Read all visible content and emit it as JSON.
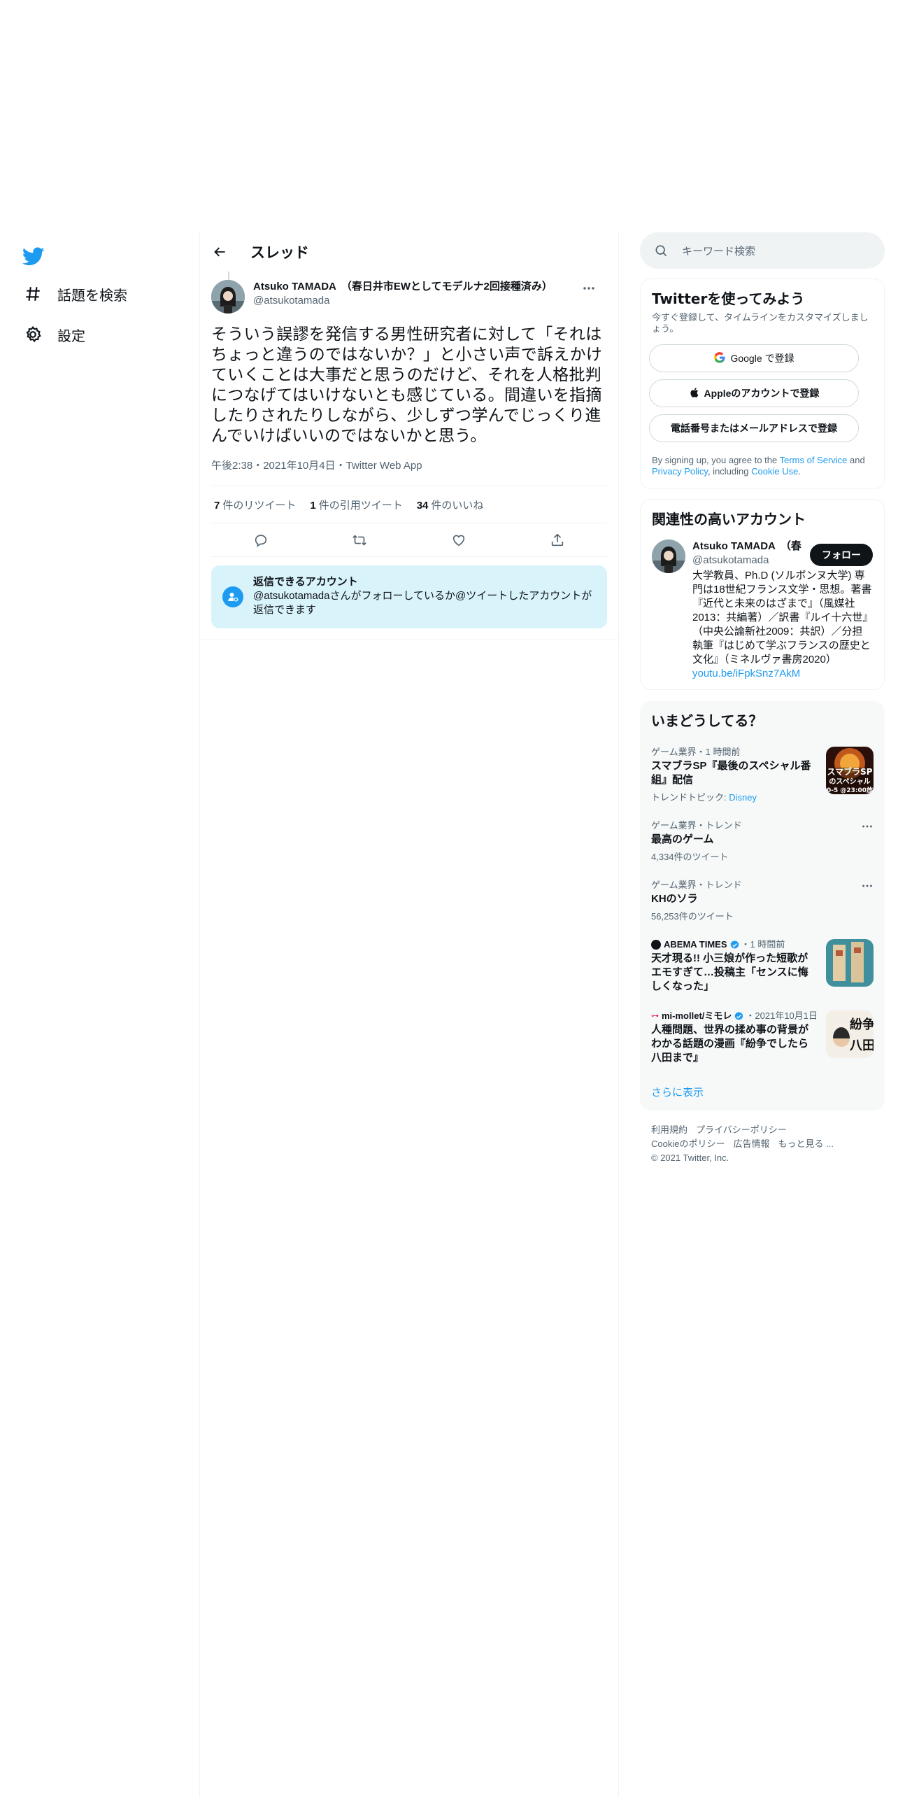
{
  "nav": {
    "items": [
      {
        "label": "話題を検索",
        "icon": "hashtag-icon"
      },
      {
        "label": "設定",
        "icon": "gear-icon"
      }
    ]
  },
  "header": {
    "title": "スレッド"
  },
  "tweet": {
    "display_name": "Atsuko TAMADA　（春日井市EWとしてモデルナ2回接種済み）",
    "handle": "@atsukotamada",
    "text": "そういう誤謬を発信する男性研究者に対して「それはちょっと違うのではないか？」と小さい声で訴えかけていくことは大事だと思うのだけど、それを人格批判につなげてはいけないとも感じている。間違いを指摘したりされたりしながら、少しずつ学んでじっくり進んでいけばいいのではないかと思う。",
    "meta": "午後2:38・2021年10月4日・Twitter Web App",
    "stats": [
      {
        "count": "7",
        "label": "件のリツイート"
      },
      {
        "count": "1",
        "label": "件の引用ツイート"
      },
      {
        "count": "34",
        "label": "件のいいね"
      }
    ],
    "reply_box": {
      "title": "返信できるアカウント",
      "text": "@atsukotamadaさんがフォローしているか@ツイートしたアカウントが返信できます"
    }
  },
  "search": {
    "placeholder": "キーワード検索"
  },
  "signup": {
    "title": "Twitterを使ってみよう",
    "subtitle": "今すぐ登録して、タイムラインをカスタマイズしましょう。",
    "google_label": "Google で登録",
    "apple_label": "Appleのアカウントで登録",
    "phone_label": "電話番号またはメールアドレスで登録",
    "terms_prefix": "By signing up, you agree to the ",
    "terms_link": "Terms of Service",
    "terms_and": " and ",
    "privacy_link": "Privacy Policy",
    "terms_including": ", including ",
    "cookie_link": "Cookie Use",
    "terms_end": "."
  },
  "relevant": {
    "title": "関連性の高いアカウント",
    "name": "Atsuko TAMADA　（春",
    "handle": "@atsukotamada",
    "follow_label": "フォロー",
    "bio": "大学教員、Ph.D (ソルボンヌ大学) 専門は18世紀フランス文学・思想。著書『近代と未来のはざまで』（風媒社2013：共編著）／訳書『ルイ十六世』（中央公論新社2009：共訳）／分担執筆『はじめて学ぶフランスの歴史と文化』（ミネルヴァ書房2020）",
    "bio_link": "youtu.be/iFpkSnz7AkM"
  },
  "trends": {
    "title": "いまどうしてる？",
    "items": [
      {
        "meta": "ゲーム業界・1 時間前",
        "title": "スマブラSP『最後のスペシャル番組』配信",
        "sub_prefix": "トレンドトピック: ",
        "sub_link": "Disney",
        "thumb_text": "スマブラSP\nのスペシャル\n0-5 @23:00放"
      },
      {
        "meta": "ゲーム業界・トレンド",
        "title": "最高のゲーム",
        "sub": "4,334件のツイート"
      },
      {
        "meta": "ゲーム業界・トレンド",
        "title": "KHのソラ",
        "sub": "56,253件のツイート"
      },
      {
        "source": "ABEMA TIMES",
        "meta": "・1 時間前",
        "title": "天才現る!! 小三娘が作った短歌がエモすぎて…投稿主「センスに悔しくなった」"
      },
      {
        "source": "mi-mollet/ミモレ",
        "meta": "・2021年10月1日",
        "title": "人種問題、世界の揉め事の背景がわかる話題の漫画『紛争でしたら八田まで』",
        "thumb_text": "紛争\n八田"
      }
    ],
    "show_more": "さらに表示"
  },
  "footer": {
    "links": [
      "利用規約",
      "プライバシーポリシー",
      "Cookieのポリシー",
      "広告情報",
      "もっと見る ..."
    ],
    "copyright": "© 2021 Twitter, Inc."
  },
  "colors": {
    "accent": "#1d9bf0",
    "text": "#0f1419",
    "muted": "#536471",
    "reply_bg": "#d9f3fb"
  }
}
